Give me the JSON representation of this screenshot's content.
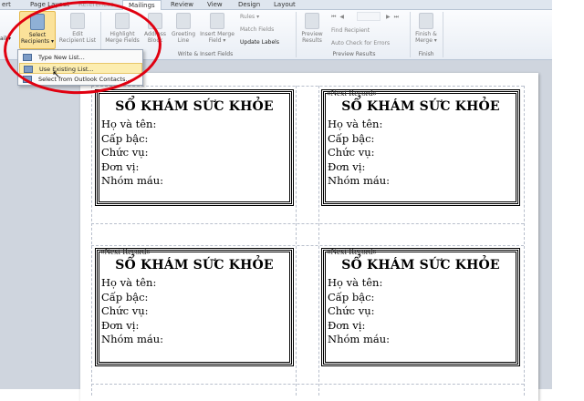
{
  "tabs": [
    "ert",
    "Page Layout",
    "References",
    "Mailings",
    "Review",
    "View",
    "Design",
    "Layout"
  ],
  "active_tab": "Mailings",
  "ribbon": {
    "start_mail_merge": "ail\n▾",
    "select_recipients": [
      "Select",
      "Recipients ▾"
    ],
    "edit_recipient_list": [
      "Edit",
      "Recipient List"
    ],
    "highlight_merge_fields": [
      "Highlight",
      "Merge Fields"
    ],
    "address_block": [
      "Address",
      "Block"
    ],
    "greeting_line": [
      "Greeting",
      "Line"
    ],
    "insert_merge_field": [
      "Insert Merge",
      "Field ▾"
    ],
    "rules": "Rules ▾",
    "match_fields": "Match Fields",
    "update_labels": "Update Labels",
    "write_insert_group": "Write & Insert Fields",
    "preview_results": [
      "Preview",
      "Results"
    ],
    "find_recipient": "Find Recipient",
    "auto_check": "Auto Check for Errors",
    "preview_group": "Preview Results",
    "finish_merge": [
      "Finish &",
      "Merge ▾"
    ],
    "finish_group": "Finish"
  },
  "menu": [
    {
      "label": "Type New List...",
      "highlighted": false
    },
    {
      "label": "Use Existing List...",
      "highlighted": true
    },
    {
      "label": "Select from Outlook Contacts...",
      "highlighted": false
    }
  ],
  "labels": {
    "title": "SỔ KHÁM SỨC KHỎE",
    "fields": [
      "Họ và tên:",
      "Cấp bậc:",
      "Chức vụ:",
      "Đơn vị:",
      "Nhóm máu:"
    ],
    "next_record": "«Next Record»"
  },
  "annotation_color": "#e00010"
}
